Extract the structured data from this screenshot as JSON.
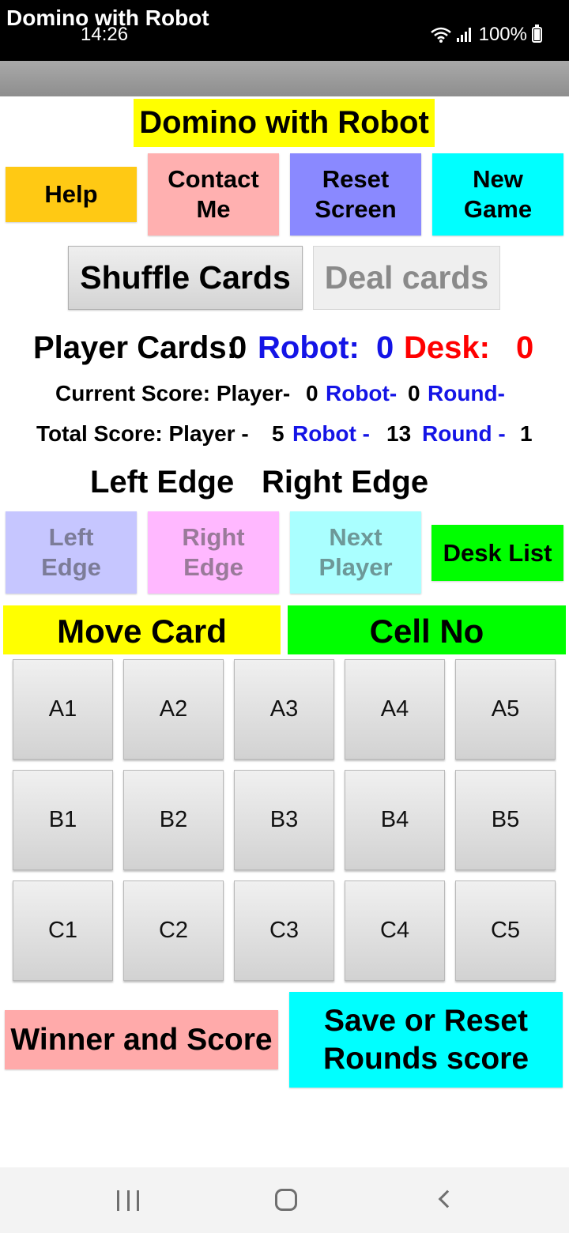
{
  "status_bar": {
    "time": "14:26",
    "battery": "100%"
  },
  "app_bar": {
    "title": "Domino with Robot"
  },
  "header": {
    "title": "Domino with Robot"
  },
  "buttons": {
    "help": "Help",
    "contact_line1": "Contact",
    "contact_line2": "Me",
    "reset_line1": "Reset",
    "reset_line2": "Screen",
    "newgame_line1": "New",
    "newgame_line2": "Game",
    "shuffle": "Shuffle Cards",
    "deal": "Deal cards",
    "left_edge_line1": "Left",
    "left_edge_line2": "Edge",
    "right_edge_line1": "Right",
    "right_edge_line2": "Edge",
    "next_player_line1": "Next",
    "next_player_line2": "Player",
    "desk_list": "Desk List",
    "winner": "Winner and Score",
    "save_line1": "Save or Reset",
    "save_line2": "Rounds score"
  },
  "cards_count": {
    "player_label": "Player Cards:",
    "player_value": "0",
    "robot_label": "Robot:",
    "robot_value": "0",
    "desk_label": "Desk:",
    "desk_value": "0"
  },
  "current_score": {
    "label": "Current Score: Player-",
    "player": "0",
    "robot_label": "Robot-",
    "robot": "0",
    "round_label": "Round-"
  },
  "total_score": {
    "label": "Total Score: Player -",
    "player": "5",
    "robot_label": "Robot -",
    "robot": "13",
    "round_label": "Round -",
    "round": "1"
  },
  "edges": {
    "left": "Left Edge",
    "right": "Right Edge"
  },
  "move_card": "Move Card",
  "cell_no": "Cell No",
  "grid": {
    "rows": [
      [
        "A1",
        "A2",
        "A3",
        "A4",
        "A5"
      ],
      [
        "B1",
        "B2",
        "B3",
        "B4",
        "B5"
      ],
      [
        "C1",
        "C2",
        "C3",
        "C4",
        "C5"
      ]
    ]
  },
  "colors": {
    "robot_blue": "#1414e6",
    "desk_red": "#ff0000",
    "title_yellow": "#ffff00",
    "cell_green": "#00ff00",
    "cyan": "#00ffff"
  },
  "icons": {
    "status": [
      "wifi-icon",
      "signal-icon",
      "battery-icon"
    ],
    "nav": [
      "recent-apps-icon",
      "home-icon",
      "back-icon"
    ]
  }
}
